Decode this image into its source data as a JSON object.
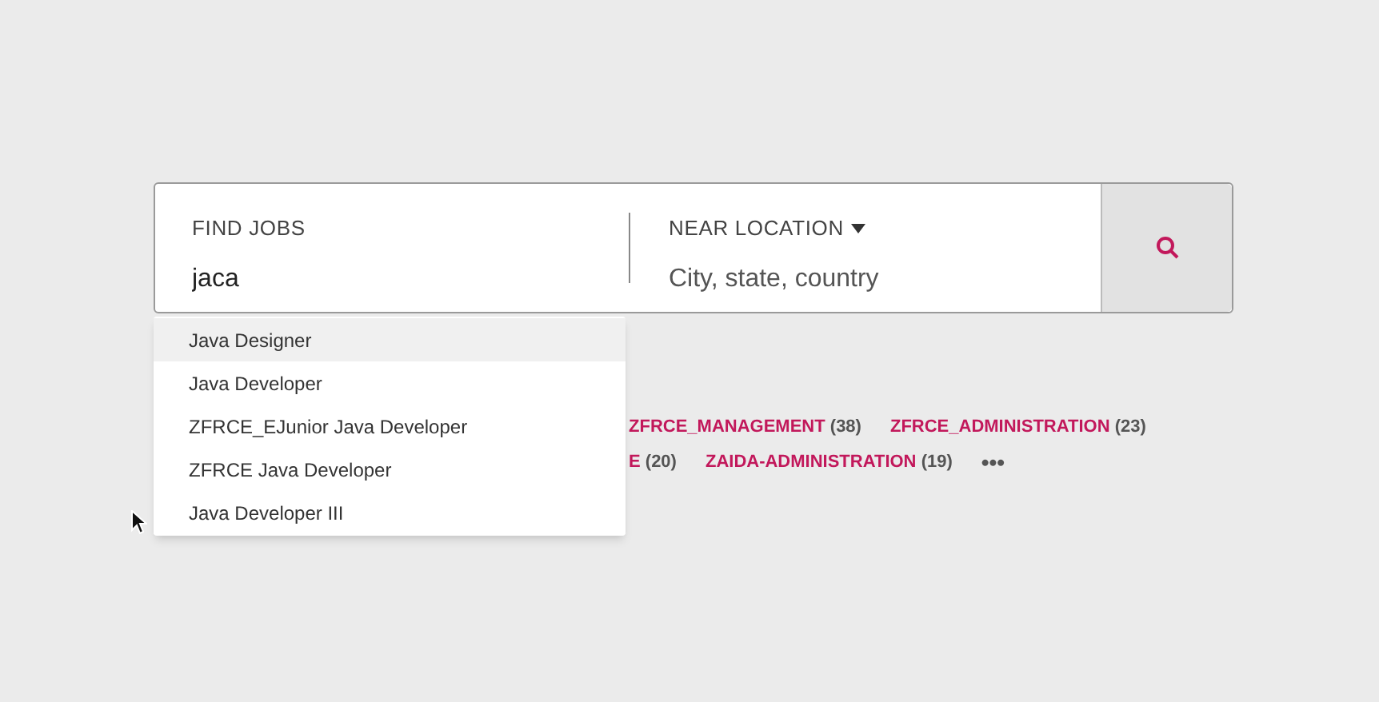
{
  "search": {
    "find_label": "FIND JOBS",
    "find_value": "jaca",
    "location_label": "NEAR LOCATION",
    "location_placeholder": "City, state, country"
  },
  "suggestions": [
    {
      "label": "Java Designer",
      "selected": true
    },
    {
      "label": "Java Developer",
      "selected": false
    },
    {
      "label": "ZFRCE_EJunior Java Developer",
      "selected": false
    },
    {
      "label": "ZFRCE Java Developer",
      "selected": false
    },
    {
      "label": "Java Developer III",
      "selected": false
    }
  ],
  "tag_rows": [
    [
      {
        "name": "ZFRCE_MANAGEMENT",
        "count": "(38)"
      },
      {
        "name": "ZFRCE_ADMINISTRATION",
        "count": "(23)"
      }
    ],
    [
      {
        "name": "E",
        "count": "(20)"
      },
      {
        "name": "ZAIDA-ADMINISTRATION",
        "count": "(19)"
      }
    ]
  ],
  "more": "•••"
}
